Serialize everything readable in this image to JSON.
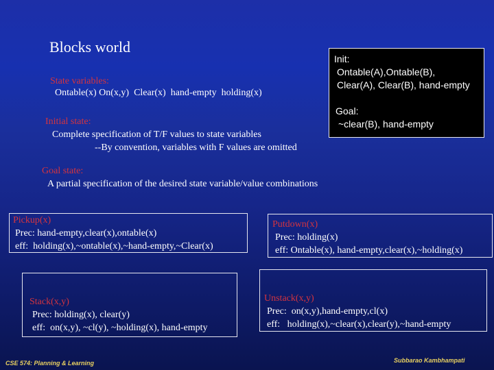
{
  "slide": {
    "title": "Blocks world",
    "state_variables": {
      "heading": "State variables:",
      "body": "Ontable(x) On(x,y)  Clear(x)  hand-empty  holding(x)"
    },
    "initial_state": {
      "heading": "Initial state:",
      "line1": "Complete specification of T/F values to state variables",
      "line2": "--By convention, variables with F values are omitted"
    },
    "goal_state": {
      "heading": "Goal state:",
      "body": "A partial specification of the desired state variable/value combinations"
    },
    "init_box": {
      "init_label": "Init:",
      "init_line1": "Ontable(A),Ontable(B),",
      "init_line2": "Clear(A), Clear(B), hand-empty",
      "goal_label": "Goal:",
      "goal_line1": "~clear(B), hand-empty"
    },
    "actions": {
      "pickup": {
        "name": "Pickup(x)",
        "prec": "Prec: hand-empty,clear(x),ontable(x)",
        "eff": "eff:  holding(x),~ontable(x),~hand-empty,~Clear(x)"
      },
      "putdown": {
        "name": "Putdown(x)",
        "prec": "Prec: holding(x)",
        "eff": "eff: Ontable(x), hand-empty,clear(x),~holding(x)"
      },
      "stack": {
        "name": "Stack(x,y)",
        "prec": "Prec: holding(x), clear(y)",
        "eff": "eff:  on(x,y), ~cl(y), ~holding(x), hand-empty"
      },
      "unstack": {
        "name": "Unstack(x,y)",
        "prec": "Prec:  on(x,y),hand-empty,cl(x)",
        "eff": "eff:   holding(x),~clear(x),clear(y),~hand-empty"
      }
    },
    "footer": {
      "left": "CSE 574: Planning & Learning",
      "right": "Subbarao Kambhampati"
    },
    "colors": {
      "heading": "#d4343f",
      "text": "#ffffff",
      "footer": "#e8d060",
      "background": "#1a2f9c"
    }
  }
}
